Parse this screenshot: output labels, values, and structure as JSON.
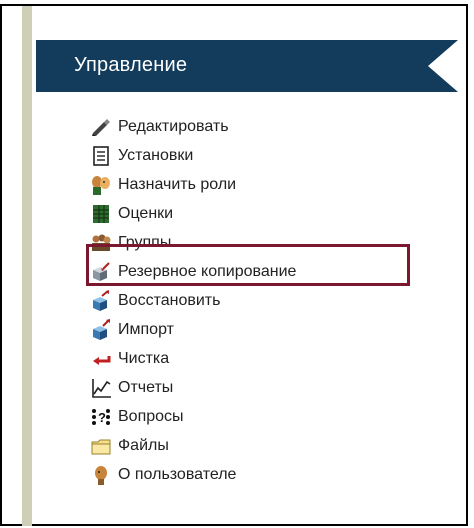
{
  "header": {
    "title": "Управление"
  },
  "menu": {
    "items": [
      {
        "label": "Редактировать",
        "icon": "edit-icon"
      },
      {
        "label": "Установки",
        "icon": "settings-document-icon"
      },
      {
        "label": "Назначить роли",
        "icon": "assign-roles-icon"
      },
      {
        "label": "Оценки",
        "icon": "grades-icon"
      },
      {
        "label": "Группы",
        "icon": "groups-icon"
      },
      {
        "label": "Резервное копирование",
        "icon": "backup-icon"
      },
      {
        "label": "Восстановить",
        "icon": "restore-icon"
      },
      {
        "label": "Импорт",
        "icon": "import-icon"
      },
      {
        "label": "Чистка",
        "icon": "reset-icon"
      },
      {
        "label": "Отчеты",
        "icon": "reports-icon"
      },
      {
        "label": "Вопросы",
        "icon": "questions-icon"
      },
      {
        "label": "Файлы",
        "icon": "files-icon"
      },
      {
        "label": "О пользователе",
        "icon": "profile-icon"
      }
    ],
    "highlighted_index": 5
  },
  "colors": {
    "header_bg": "#123b5c",
    "highlight_border": "#7b1830",
    "rail": "#cfcfb8"
  }
}
